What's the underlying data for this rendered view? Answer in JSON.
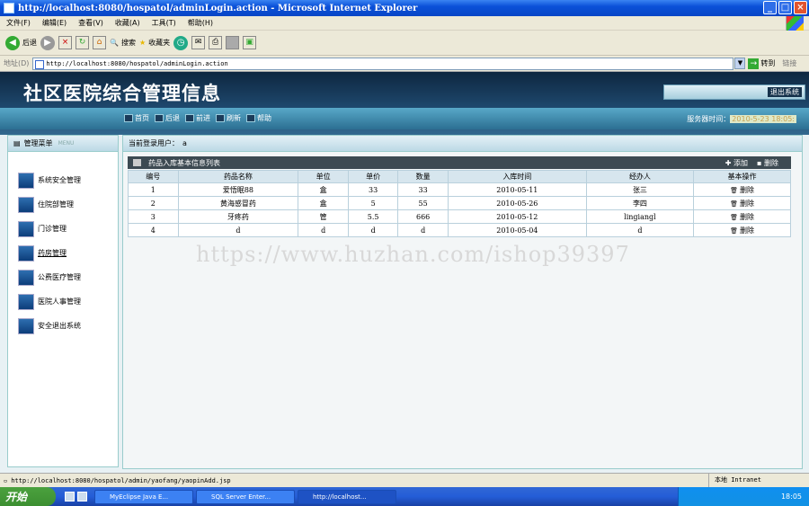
{
  "window": {
    "title": "http://localhost:8080/hospatol/adminLogin.action - Microsoft Internet Explorer"
  },
  "menu": [
    "文件(F)",
    "编辑(E)",
    "查看(V)",
    "收藏(A)",
    "工具(T)",
    "帮助(H)"
  ],
  "toolbar": {
    "back": "后退",
    "search": "搜索",
    "favorites": "收藏夹"
  },
  "address": {
    "label": "地址(D)",
    "url": "http://localhost:8080/hospatol/adminLogin.action",
    "go": "转到",
    "links": "链接"
  },
  "app": {
    "title": "社区医院综合管理信息",
    "logout": "退出系统",
    "nav": [
      "首页",
      "后退",
      "前进",
      "刷新",
      "帮助"
    ],
    "server_time_label": "服务器时间：",
    "server_time": "2010-5-23 18:05:"
  },
  "sidebar": {
    "header": "管理菜单",
    "header_sub": "MENU",
    "items": [
      "系统安全管理",
      "住院部管理",
      "门诊管理",
      "药房管理",
      "公费医疗管理",
      "医院人事管理",
      "安全退出系统"
    ]
  },
  "main": {
    "current_user_label": "当前登录用户：",
    "current_user": "a",
    "table_title": "药品入库基本信息列表",
    "add_label": "添加",
    "delete_label": "删除",
    "columns": [
      "编号",
      "药品名称",
      "单位",
      "单价",
      "数量",
      "入库时间",
      "经办人",
      "基本操作"
    ],
    "rows": [
      [
        "1",
        "爱悟眠88",
        "盒",
        "33",
        "33",
        "2010-05-11",
        "张三",
        "删除"
      ],
      [
        "2",
        "黄海感冒药",
        "盒",
        "5",
        "55",
        "2010-05-26",
        "李四",
        "删除"
      ],
      [
        "3",
        "牙疼药",
        "管",
        "5.5",
        "666",
        "2010-05-12",
        "lingiangl",
        "删除"
      ],
      [
        "4",
        "d",
        "d",
        "d",
        "d",
        "2010-05-04",
        "d",
        "删除"
      ]
    ]
  },
  "watermark": "https://www.huzhan.com/ishop39397",
  "status": {
    "url": "http://localhost:8080/hospatol/admin/yaofang/yaopinAdd.jsp",
    "zone": "本地 Intranet"
  },
  "taskbar": {
    "start": "开始",
    "tasks": [
      "MyEclipse Java E...",
      "SQL Server Enter...",
      "http://localhost..."
    ],
    "clock": "18:05"
  },
  "colors": {
    "banner": "#1f4a70",
    "titlebar": "#0a50d8",
    "start": "#3c8f31"
  }
}
